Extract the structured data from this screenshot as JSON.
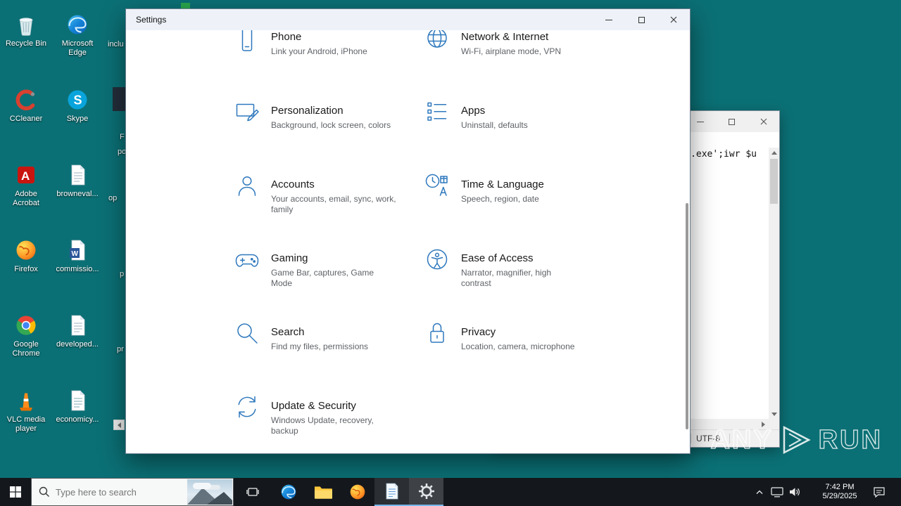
{
  "theme": {
    "desktop_teal": "#0b7075",
    "settings_icon_blue": "#2e78bd",
    "taskbar_black": "#14181d",
    "open_app_underline": "#76b9ed"
  },
  "desktop": {
    "column1": [
      {
        "label": "Recycle Bin"
      },
      {
        "label": "CCleaner"
      },
      {
        "label": "Adobe Acrobat"
      },
      {
        "label": "Firefox"
      },
      {
        "label": "Google Chrome"
      },
      {
        "label": "VLC media player"
      }
    ],
    "column2": [
      {
        "label": "Microsoft Edge"
      },
      {
        "label": "Skype"
      },
      {
        "label": "browneval..."
      },
      {
        "label": "commissio..."
      },
      {
        "label": "developed..."
      },
      {
        "label": "economicy..."
      }
    ],
    "column3_fragments": [
      "inclu",
      "F",
      "po",
      "op",
      "p",
      "pr"
    ]
  },
  "settings_window": {
    "title": "Settings",
    "categories": [
      {
        "title": "Phone",
        "subtitle": "Link your Android, iPhone"
      },
      {
        "title": "Network & Internet",
        "subtitle": "Wi-Fi, airplane mode, VPN"
      },
      {
        "title": "Personalization",
        "subtitle": "Background, lock screen, colors"
      },
      {
        "title": "Apps",
        "subtitle": "Uninstall, defaults"
      },
      {
        "title": "Accounts",
        "subtitle": "Your accounts, email, sync, work, family"
      },
      {
        "title": "Time & Language",
        "subtitle": "Speech, region, date"
      },
      {
        "title": "Gaming",
        "subtitle": "Game Bar, captures, Game Mode"
      },
      {
        "title": "Ease of Access",
        "subtitle": "Narrator, magnifier, high contrast"
      },
      {
        "title": "Search",
        "subtitle": "Find my files, permissions"
      },
      {
        "title": "Privacy",
        "subtitle": "Location, camera, microphone"
      },
      {
        "title": "Update & Security",
        "subtitle": "Windows Update, recovery, backup"
      }
    ]
  },
  "editor_window": {
    "visible_text": "n.exe';iwr $u",
    "status_encoding": "UTF-8"
  },
  "taskbar": {
    "search_placeholder": "Type here to search",
    "clock": {
      "time": "7:42 PM",
      "date": "5/29/2025"
    }
  },
  "watermark": {
    "left": "ANY",
    "right": "RUN"
  }
}
